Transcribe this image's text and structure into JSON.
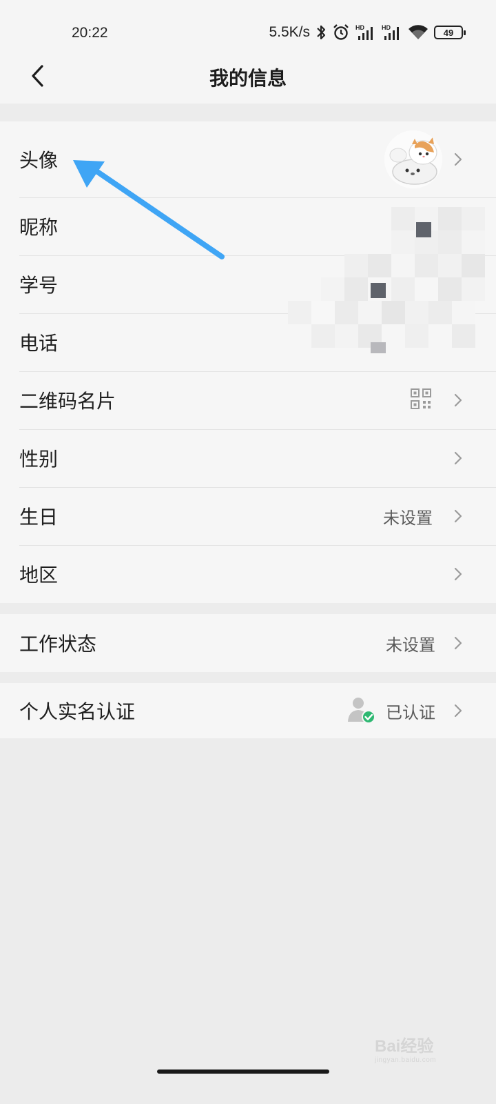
{
  "status_bar": {
    "time": "20:22",
    "network_speed": "5.5K/s",
    "battery": "49",
    "icons": [
      "bluetooth-icon",
      "alarm-icon",
      "signal-hd-icon",
      "signal-hd-icon",
      "wifi-icon",
      "battery-icon"
    ]
  },
  "header": {
    "title": "我的信息",
    "back_icon": "back-chevron-icon"
  },
  "profile_section": {
    "items": [
      {
        "label": "头像",
        "value": "",
        "right_icon": "avatar-image"
      },
      {
        "label": "昵称",
        "value": ""
      },
      {
        "label": "学号",
        "value": ""
      },
      {
        "label": "电话",
        "value": ""
      },
      {
        "label": "二维码名片",
        "value": "",
        "right_icon": "qr-code-icon"
      },
      {
        "label": "性别",
        "value": ""
      },
      {
        "label": "生日",
        "value": "未设置"
      },
      {
        "label": "地区",
        "value": ""
      }
    ]
  },
  "work_section": {
    "items": [
      {
        "label": "工作状态",
        "value": "未设置"
      }
    ]
  },
  "verify_section": {
    "items": [
      {
        "label": "个人实名认证",
        "value": "已认证",
        "right_icon": "verified-user-icon"
      }
    ]
  },
  "watermark": {
    "text": "Bai经验",
    "sub": "jingyan.baidu.com"
  },
  "colors": {
    "background": "#ececec",
    "card": "#f6f6f6",
    "annotation_arrow": "#3fa5f5",
    "verified_check": "#2eb872"
  }
}
